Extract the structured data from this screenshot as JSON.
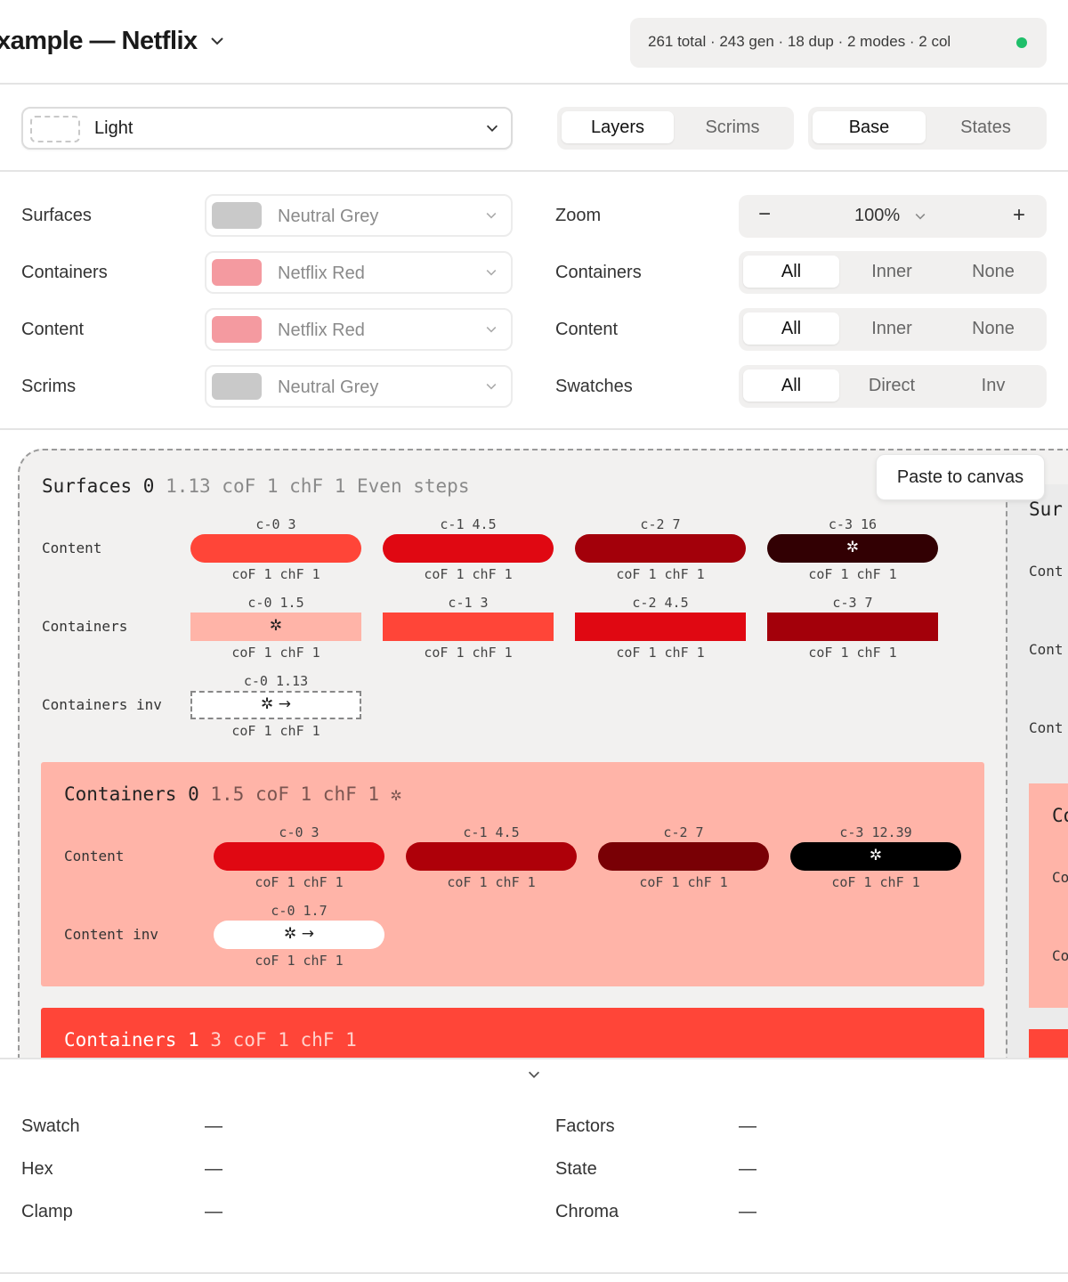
{
  "header": {
    "title": "xample — Netflix",
    "stats": "261 total · 243 gen · 18 dup · 2 modes · 2 col",
    "status_color": "#1fbf6a"
  },
  "mode_bar": {
    "mode": "Light",
    "view_tabs": [
      "Layers",
      "Scrims"
    ],
    "state_tabs": [
      "Base",
      "States"
    ]
  },
  "settings": {
    "left": [
      {
        "label": "Surfaces",
        "value": "Neutral Grey",
        "swatch": "#c9c9c9"
      },
      {
        "label": "Containers",
        "value": "Netflix Red",
        "swatch": "#f49aa0"
      },
      {
        "label": "Content",
        "value": "Netflix Red",
        "swatch": "#f49aa0"
      },
      {
        "label": "Scrims",
        "value": "Neutral Grey",
        "swatch": "#c9c9c9"
      }
    ],
    "zoom": {
      "label": "Zoom",
      "minus": "−",
      "value": "100%",
      "plus": "+"
    },
    "right": [
      {
        "label": "Containers",
        "options": [
          "All",
          "Inner",
          "None"
        ]
      },
      {
        "label": "Content",
        "options": [
          "All",
          "Inner",
          "None"
        ]
      },
      {
        "label": "Swatches",
        "options": [
          "All",
          "Direct",
          "Inv"
        ]
      }
    ]
  },
  "canvas": {
    "paste_label": "Paste to canvas",
    "surfaces": {
      "title": "Surfaces 0",
      "meta": "1.13 coF 1 chF 1 Even steps",
      "rows": [
        {
          "label": "Content",
          "swatches": [
            {
              "top": "c-0 3",
              "bottom": "coF 1 chF 1",
              "color": "#ff4538",
              "mark": ""
            },
            {
              "top": "c-1 4.5",
              "bottom": "coF 1 chF 1",
              "color": "#e00812",
              "mark": ""
            },
            {
              "top": "c-2 7",
              "bottom": "coF 1 chF 1",
              "color": "#a3000a",
              "mark": ""
            },
            {
              "top": "c-3 16",
              "bottom": "coF 1 chF 1",
              "color": "#320003",
              "mark": "✲"
            }
          ]
        },
        {
          "label": "Containers",
          "swatches": [
            {
              "top": "c-0 1.5",
              "bottom": "coF 1 chF 1",
              "color": "#ffb4a8",
              "mark": "✲"
            },
            {
              "top": "c-1 3",
              "bottom": "coF 1 chF 1",
              "color": "#ff4538",
              "mark": ""
            },
            {
              "top": "c-2 4.5",
              "bottom": "coF 1 chF 1",
              "color": "#e00812",
              "mark": ""
            },
            {
              "top": "c-3 7",
              "bottom": "coF 1 chF 1",
              "color": "#a3000a",
              "mark": ""
            }
          ]
        },
        {
          "label": "Containers inv",
          "swatches": [
            {
              "top": "c-0 1.13",
              "bottom": "coF 1 chF 1",
              "color": "#ffffff",
              "mark": "✲ →"
            }
          ]
        }
      ]
    },
    "containers0": {
      "title": "Containers 0",
      "meta": "1.5 coF 1 chF 1 ✲",
      "bg": "#ffb4a8",
      "rows": [
        {
          "label": "Content",
          "swatches": [
            {
              "top": "c-0 3",
              "bottom": "coF 1 chF 1",
              "color": "#e00812",
              "mark": ""
            },
            {
              "top": "c-1 4.5",
              "bottom": "coF 1 chF 1",
              "color": "#ae0009",
              "mark": ""
            },
            {
              "top": "c-2 7",
              "bottom": "coF 1 chF 1",
              "color": "#790005",
              "mark": ""
            },
            {
              "top": "c-3 12.39",
              "bottom": "coF 1 chF 1",
              "color": "#000000",
              "mark": "✲"
            }
          ]
        },
        {
          "label": "Content inv",
          "swatches": [
            {
              "top": "c-0 1.7",
              "bottom": "coF 1 chF 1",
              "color": "#ffffff",
              "mark": "✲ →"
            }
          ]
        }
      ]
    },
    "containers1": {
      "title": "Containers 1",
      "meta": "3 coF 1 chF 1",
      "bg": "#ff4538"
    },
    "right_partial": {
      "title": "Sur",
      "rows": [
        "Cont",
        "Cont",
        "Cont"
      ],
      "inner_title": "Co",
      "inner_rows": [
        "Co",
        "Co"
      ]
    }
  },
  "details": {
    "left": [
      {
        "label": "Swatch",
        "value": "—"
      },
      {
        "label": "Hex",
        "value": "—"
      },
      {
        "label": "Clamp",
        "value": "—"
      }
    ],
    "right": [
      {
        "label": "Factors",
        "value": "—"
      },
      {
        "label": "State",
        "value": "—"
      },
      {
        "label": "Chroma",
        "value": "—"
      }
    ]
  }
}
